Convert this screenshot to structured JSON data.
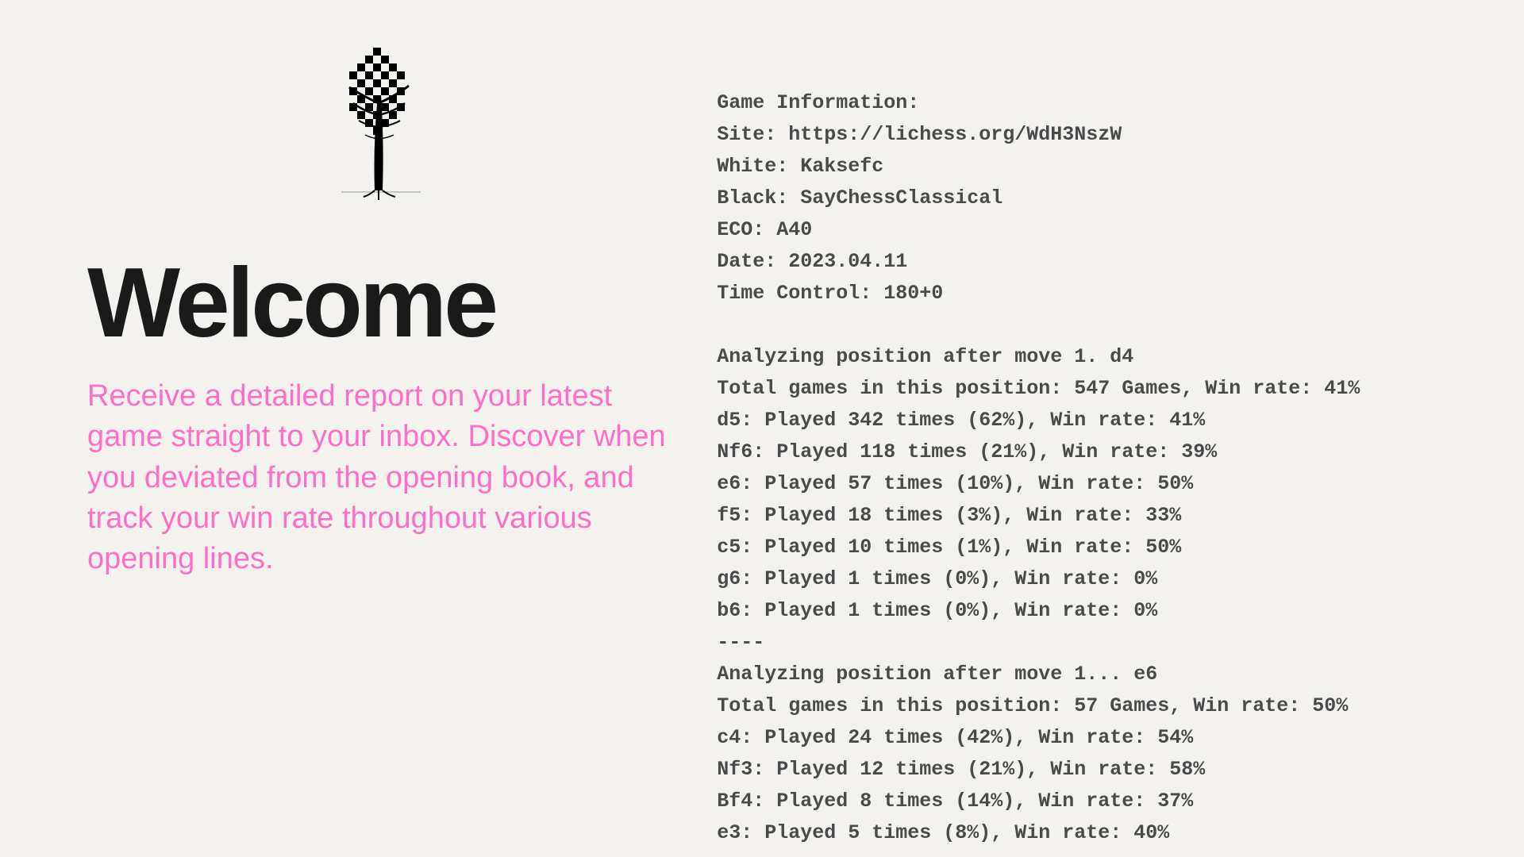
{
  "left": {
    "title": "Welcome",
    "description": "Receive a detailed report on your latest game straight to your inbox. Discover when you deviated from the opening book, and track your win rate throughout various opening lines."
  },
  "report": {
    "header_label": "Game Information:",
    "site_label": "Site:",
    "site_value": "https://lichess.org/WdH3NszW",
    "white_label": "White:",
    "white_value": "Kaksefc",
    "black_label": "Black:",
    "black_value": "SayChessClassical",
    "eco_label": "ECO:",
    "eco_value": "A40",
    "date_label": "Date:",
    "date_value": "2023.04.11",
    "tc_label": "Time Control:",
    "tc_value": "180+0",
    "pos1": {
      "analyzing": "Analyzing position after move 1. d4",
      "total": "Total games in this position: 547 Games, Win rate: 41%",
      "moves": [
        "d5: Played 342 times (62%), Win rate: 41%",
        "Nf6: Played 118 times (21%), Win rate: 39%",
        "e6: Played 57 times (10%), Win rate: 50%",
        "f5: Played 18 times (3%), Win rate: 33%",
        "c5: Played 10 times (1%), Win rate: 50%",
        "g6: Played 1 times (0%), Win rate: 0%",
        "b6: Played 1 times (0%), Win rate: 0%"
      ],
      "divider": "----"
    },
    "pos2": {
      "analyzing": "Analyzing position after move 1... e6",
      "total": "Total games in this position: 57 Games, Win rate: 50%",
      "moves": [
        "c4: Played 24 times (42%), Win rate: 54%",
        "Nf3: Played 12 times (21%), Win rate: 58%",
        "Bf4: Played 8 times (14%), Win rate: 37%",
        "e3: Played 5 times (8%), Win rate: 40%"
      ]
    }
  }
}
